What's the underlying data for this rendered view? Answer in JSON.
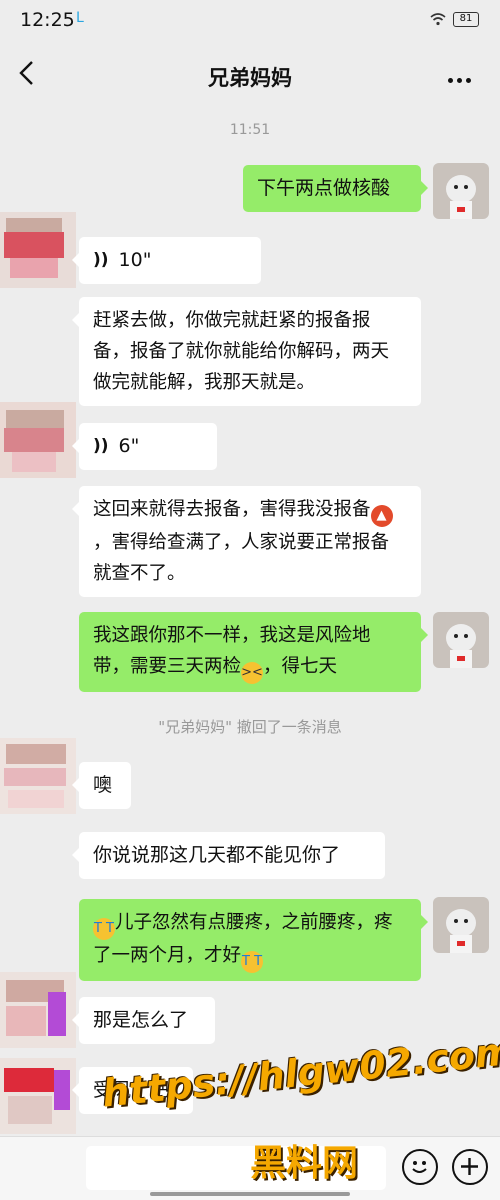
{
  "status_bar": {
    "time": "12:25",
    "app_mark": "L",
    "battery": "81"
  },
  "header": {
    "title": "兄弟妈妈"
  },
  "chat": {
    "timestamp": "11:51",
    "recall_notice": "\"兄弟妈妈\" 撤回了一条消息",
    "messages": [
      {
        "side": "out",
        "text": "下午两点做核酸"
      },
      {
        "side": "in",
        "type": "voice",
        "duration": "10\""
      },
      {
        "side": "in",
        "text": "赶紧去做，你做完就赶紧的报备报备，报备了就你就能给你解码，两天做完就能解，我那天就是。"
      },
      {
        "side": "in",
        "type": "voice",
        "duration": "6\""
      },
      {
        "side": "in",
        "text_a": "这回来就得去报备，害得我没报备",
        "text_b": "，害得给查满了，人家说要正常报备就查不了。"
      },
      {
        "side": "out",
        "text_a": "我这跟你那不一样，我这是风险地带，需要三天两检",
        "text_b": "，得七天"
      },
      {
        "side": "in",
        "text": "噢"
      },
      {
        "side": "in",
        "text": "你说说那这几天都不能见你了"
      },
      {
        "side": "out",
        "text_a": "儿子忽然有点腰疼，之前腰疼，疼了一两个月，才好"
      },
      {
        "side": "in",
        "text": "那是怎么了"
      },
      {
        "side": "in",
        "text": "受风了吧"
      }
    ]
  },
  "watermark": {
    "url": "https://hlgw02.com",
    "name": "黑料网"
  },
  "icons": [
    "back-arrow-icon",
    "more-icon",
    "voice-wave-icon",
    "angry-face-emoji",
    "tired-face-emoji",
    "crying-face-emoji",
    "smile-face-icon",
    "plus-icon",
    "wifi-icon",
    "battery-icon"
  ],
  "colors": {
    "background": "#ededed",
    "outgoing_bubble": "#95ec69",
    "incoming_bubble": "#ffffff",
    "watermark": "#f5a800"
  }
}
